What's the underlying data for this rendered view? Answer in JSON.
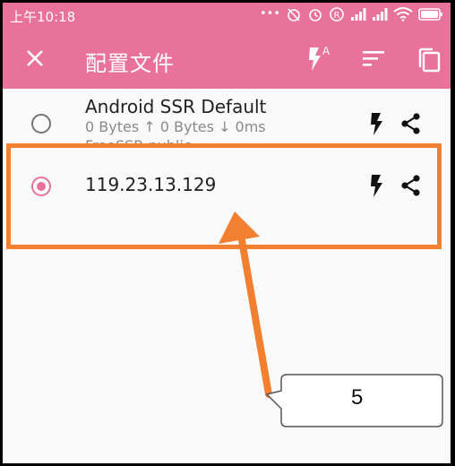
{
  "status_bar": {
    "time": "上午10:18",
    "icons": [
      "more-dots-icon",
      "alarm-off-icon",
      "alarm-icon",
      "registered-icon",
      "signal-icon",
      "signal-icon",
      "wifi-icon",
      "battery-icon"
    ]
  },
  "toolbar": {
    "title": "配置文件",
    "icons": [
      "close-icon",
      "flash-auto-icon",
      "sort-icon",
      "copy-icon"
    ]
  },
  "profiles": [
    {
      "name": "Android SSR Default",
      "upload": "0 Bytes",
      "download": "0 Bytes",
      "latency": "0ms",
      "group": "FreeSSR-public",
      "selected": false
    },
    {
      "name": "119.23.13.129",
      "selected": true
    }
  ],
  "annotation": {
    "callout_label": "5",
    "highlight_color": "#f28030"
  },
  "colors": {
    "accent": "#e9729b",
    "annotation": "#f28030"
  }
}
